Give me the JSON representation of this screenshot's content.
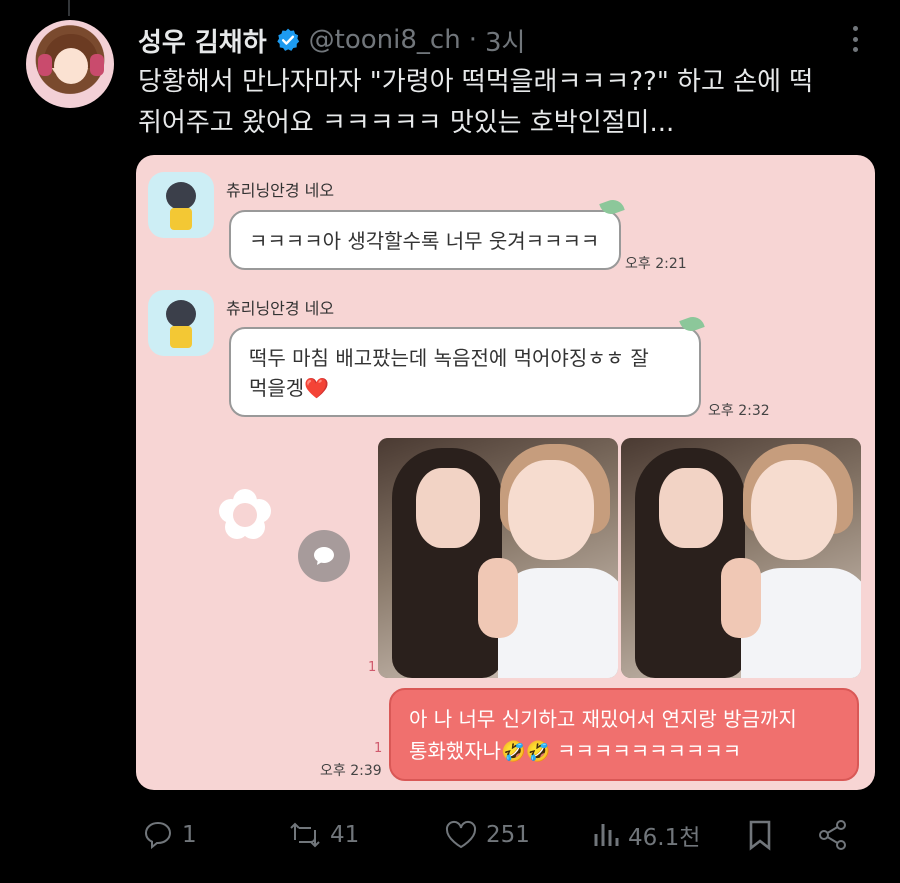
{
  "tweet": {
    "author_name": "성우 김채하",
    "handle": "@tooni8_ch",
    "separator": "·",
    "time": "3시",
    "text_line1": "당황해서 만나자마자 \"가령아 떡먹을래ㅋㅋㅋ??\" 하고 손에 떡",
    "text_line2": "쥐어주고 왔어요 ㅋㅋㅋㅋㅋ 맛있는 호박인절미..."
  },
  "chat": {
    "msg1": {
      "sender": "츄리닝안경 네오",
      "text": "ㅋㅋㅋㅋ아 생각할수록 너무 웃겨ㅋㅋㅋㅋ",
      "time": "오후 2:21"
    },
    "msg2": {
      "sender": "츄리닝안경 네오",
      "text_line1": "떡두 마침 배고팠는데 녹음전에 먹어야징ㅎㅎ 잘",
      "text_line2": "먹을겡",
      "heart": "❤️",
      "time": "오후 2:32"
    },
    "photos_read": "1",
    "msg3": {
      "read": "1",
      "text_line1": "아 나 너무 신기하고 재밌어서 연지랑 방금까지",
      "text_line2": "통화했자나🤣🤣 ㅋㅋㅋㅋㅋㅋㅋㅋㅋㅋ",
      "time": "오후 2:39"
    }
  },
  "actions": {
    "replies": "1",
    "reposts": "41",
    "likes": "251",
    "views": "46.1천"
  },
  "colors": {
    "background": "#000000",
    "text": "#e7e9ea",
    "muted": "#71767b",
    "verified": "#1d9bf0",
    "chat_bg": "#f7d5d4",
    "my_bubble": "#f0706e"
  },
  "icons": [
    "verified-badge-icon",
    "more-icon",
    "reply-icon",
    "repost-icon",
    "like-icon",
    "views-icon",
    "bookmark-icon",
    "share-icon",
    "flower-icon",
    "chat-bubble-icon"
  ]
}
